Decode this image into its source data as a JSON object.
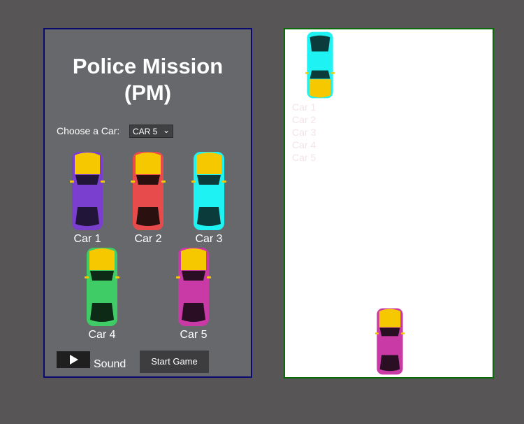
{
  "menu": {
    "title_line1": "Police Mission",
    "title_line2": "(PM)",
    "choose_label": "Choose a Car:",
    "selected_car": "CAR 5",
    "cars": [
      {
        "label": "Car 1",
        "body": "#7a3fcf",
        "window": "#22153a",
        "roof": "#7a3fcf"
      },
      {
        "label": "Car 2",
        "body": "#e84b4b",
        "window": "#2b1010",
        "roof": "#e84b4b"
      },
      {
        "label": "Car 3",
        "body": "#1ef2f2",
        "window": "#0b3b3b",
        "roof": "#1ef2f2"
      },
      {
        "label": "Car 4",
        "body": "#3fcc66",
        "window": "#0d2a16",
        "roof": "#3fcc66"
      },
      {
        "label": "Car 5",
        "body": "#c93aa6",
        "window": "#2a0f24",
        "roof": "#c93aa6"
      }
    ],
    "sound_label": "Sound",
    "start_label": "Start Game"
  },
  "arena": {
    "ghost_options": [
      "Car 1",
      "Car 2",
      "Car 3",
      "Car 4",
      "Car 5"
    ],
    "enemy_car_color": "#1ef2f2",
    "player_car_color": "#c93aa6"
  }
}
